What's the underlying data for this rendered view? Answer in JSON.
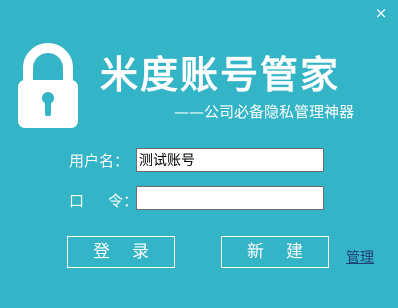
{
  "window": {
    "close_glyph": "×",
    "background_color": "#34b4c7"
  },
  "branding": {
    "logo_icon": "padlock-icon",
    "title": "米度账号管家",
    "subtitle": "——公司必备隐私管理神器"
  },
  "form": {
    "username_label": "用户名：",
    "username_value": "测试账号",
    "password_label_char1": "口",
    "password_label_char2": "令：",
    "password_value": ""
  },
  "buttons": {
    "login_label": "登录",
    "create_label": "新建"
  },
  "links": {
    "manage_label": "管理"
  }
}
